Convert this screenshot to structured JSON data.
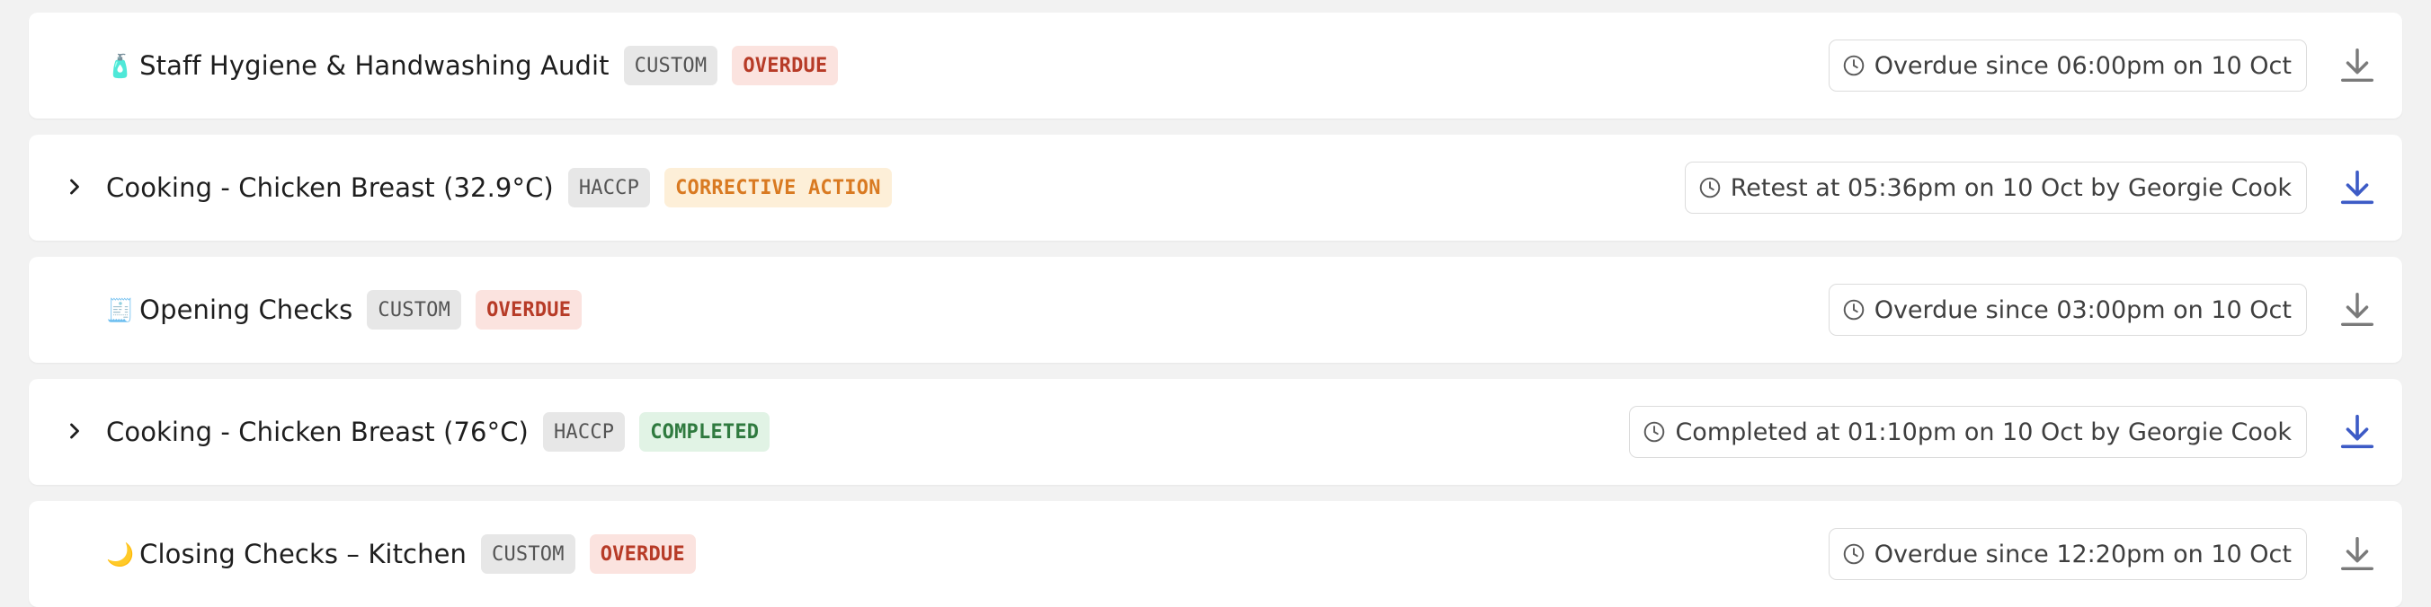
{
  "colors": {
    "page_bg": "#f2f2f2",
    "card_bg": "#ffffff",
    "overdue_text": "#b73b27",
    "overdue_bg": "#fbe3df",
    "corrective_text": "#d97a22",
    "corrective_bg": "#fdefd8",
    "completed_text": "#2f7a3f",
    "completed_bg": "#e1f3e5",
    "download_active": "#3d5bc6",
    "download_inactive": "#7a7a7a"
  },
  "checks": [
    {
      "emoji": "🧴",
      "title": "Staff Hygiene & Handwashing Audit",
      "type_badge": "CUSTOM",
      "status_badge": "OVERDUE",
      "status_kind": "overdue",
      "status_text": "Overdue since 06:00pm on 10 Oct",
      "expandable": false,
      "icons": {
        "clock": "clock-icon",
        "download": "download-icon"
      },
      "download_active": false
    },
    {
      "emoji": "",
      "title": "Cooking - Chicken Breast (32.9°C)",
      "type_badge": "HACCP",
      "status_badge": "CORRECTIVE ACTION",
      "status_kind": "corrective",
      "status_text": "Retest at 05:36pm on 10 Oct by Georgie Cook",
      "expandable": true,
      "icons": {
        "chevron": "chevron-right-icon",
        "clock": "clock-icon",
        "download": "download-icon"
      },
      "download_active": true
    },
    {
      "emoji": "🧾",
      "title": "Opening Checks",
      "type_badge": "CUSTOM",
      "status_badge": "OVERDUE",
      "status_kind": "overdue",
      "status_text": "Overdue since 03:00pm on 10 Oct",
      "expandable": false,
      "icons": {
        "clock": "clock-icon",
        "download": "download-icon"
      },
      "download_active": false
    },
    {
      "emoji": "",
      "title": "Cooking - Chicken Breast (76°C)",
      "type_badge": "HACCP",
      "status_badge": "COMPLETED",
      "status_kind": "completed",
      "status_text": "Completed at 01:10pm on 10 Oct by Georgie Cook",
      "expandable": true,
      "icons": {
        "chevron": "chevron-right-icon",
        "clock": "clock-icon",
        "download": "download-icon"
      },
      "download_active": true
    },
    {
      "emoji": "🌙",
      "title": "Closing Checks – Kitchen",
      "type_badge": "CUSTOM",
      "status_badge": "OVERDUE",
      "status_kind": "overdue",
      "status_text": "Overdue since 12:20pm on 10 Oct",
      "expandable": false,
      "icons": {
        "clock": "clock-icon",
        "download": "download-icon"
      },
      "download_active": false
    }
  ]
}
